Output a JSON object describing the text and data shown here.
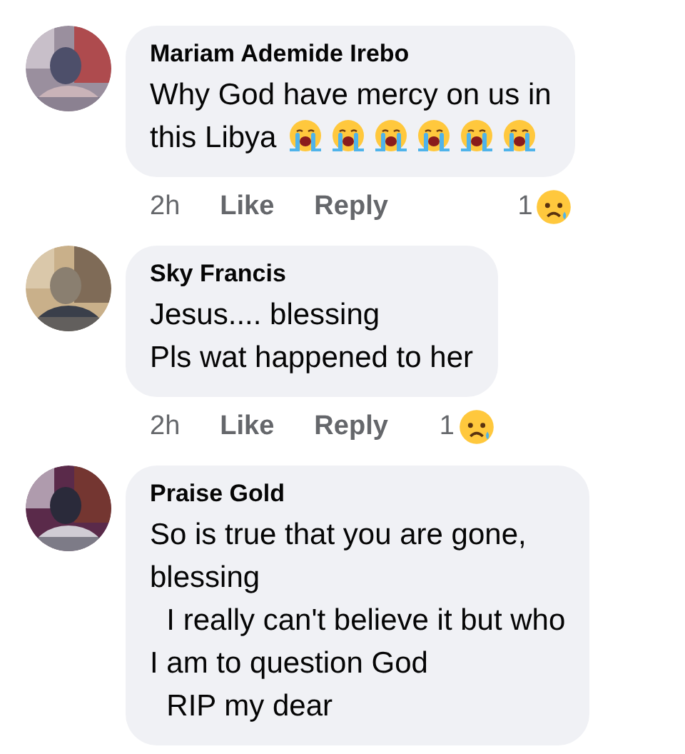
{
  "comments": [
    {
      "author": "Mariam Ademide Irebo",
      "avatar": {
        "kind": "picture"
      },
      "lines": [
        "Why God have mercy on us in",
        "this Libya"
      ],
      "emojis": [
        {
          "kind": "loudly-crying"
        },
        {
          "kind": "loudly-crying"
        },
        {
          "kind": "loudly-crying"
        },
        {
          "kind": "loudly-crying"
        },
        {
          "kind": "loudly-crying"
        },
        {
          "kind": "loudly-crying"
        }
      ],
      "time": "2h",
      "actions": [
        "Like",
        "Reply"
      ],
      "reaction": {
        "count": "1",
        "kind": "sad"
      }
    },
    {
      "author": "Sky Francis",
      "avatar": {
        "kind": "picture"
      },
      "lines": [
        "Jesus.... blessing",
        "Pls wat happened to her"
      ],
      "time": "2h",
      "actions": [
        "Like",
        "Reply"
      ],
      "reaction": {
        "count": "1",
        "kind": "sad"
      }
    },
    {
      "author": "Praise Gold",
      "avatar": {
        "kind": "picture"
      },
      "lines": [
        "So is true that you are gone,",
        "blessing",
        "  I really can't believe it but who",
        "I am to question God",
        "  RIP my dear"
      ]
    }
  ]
}
